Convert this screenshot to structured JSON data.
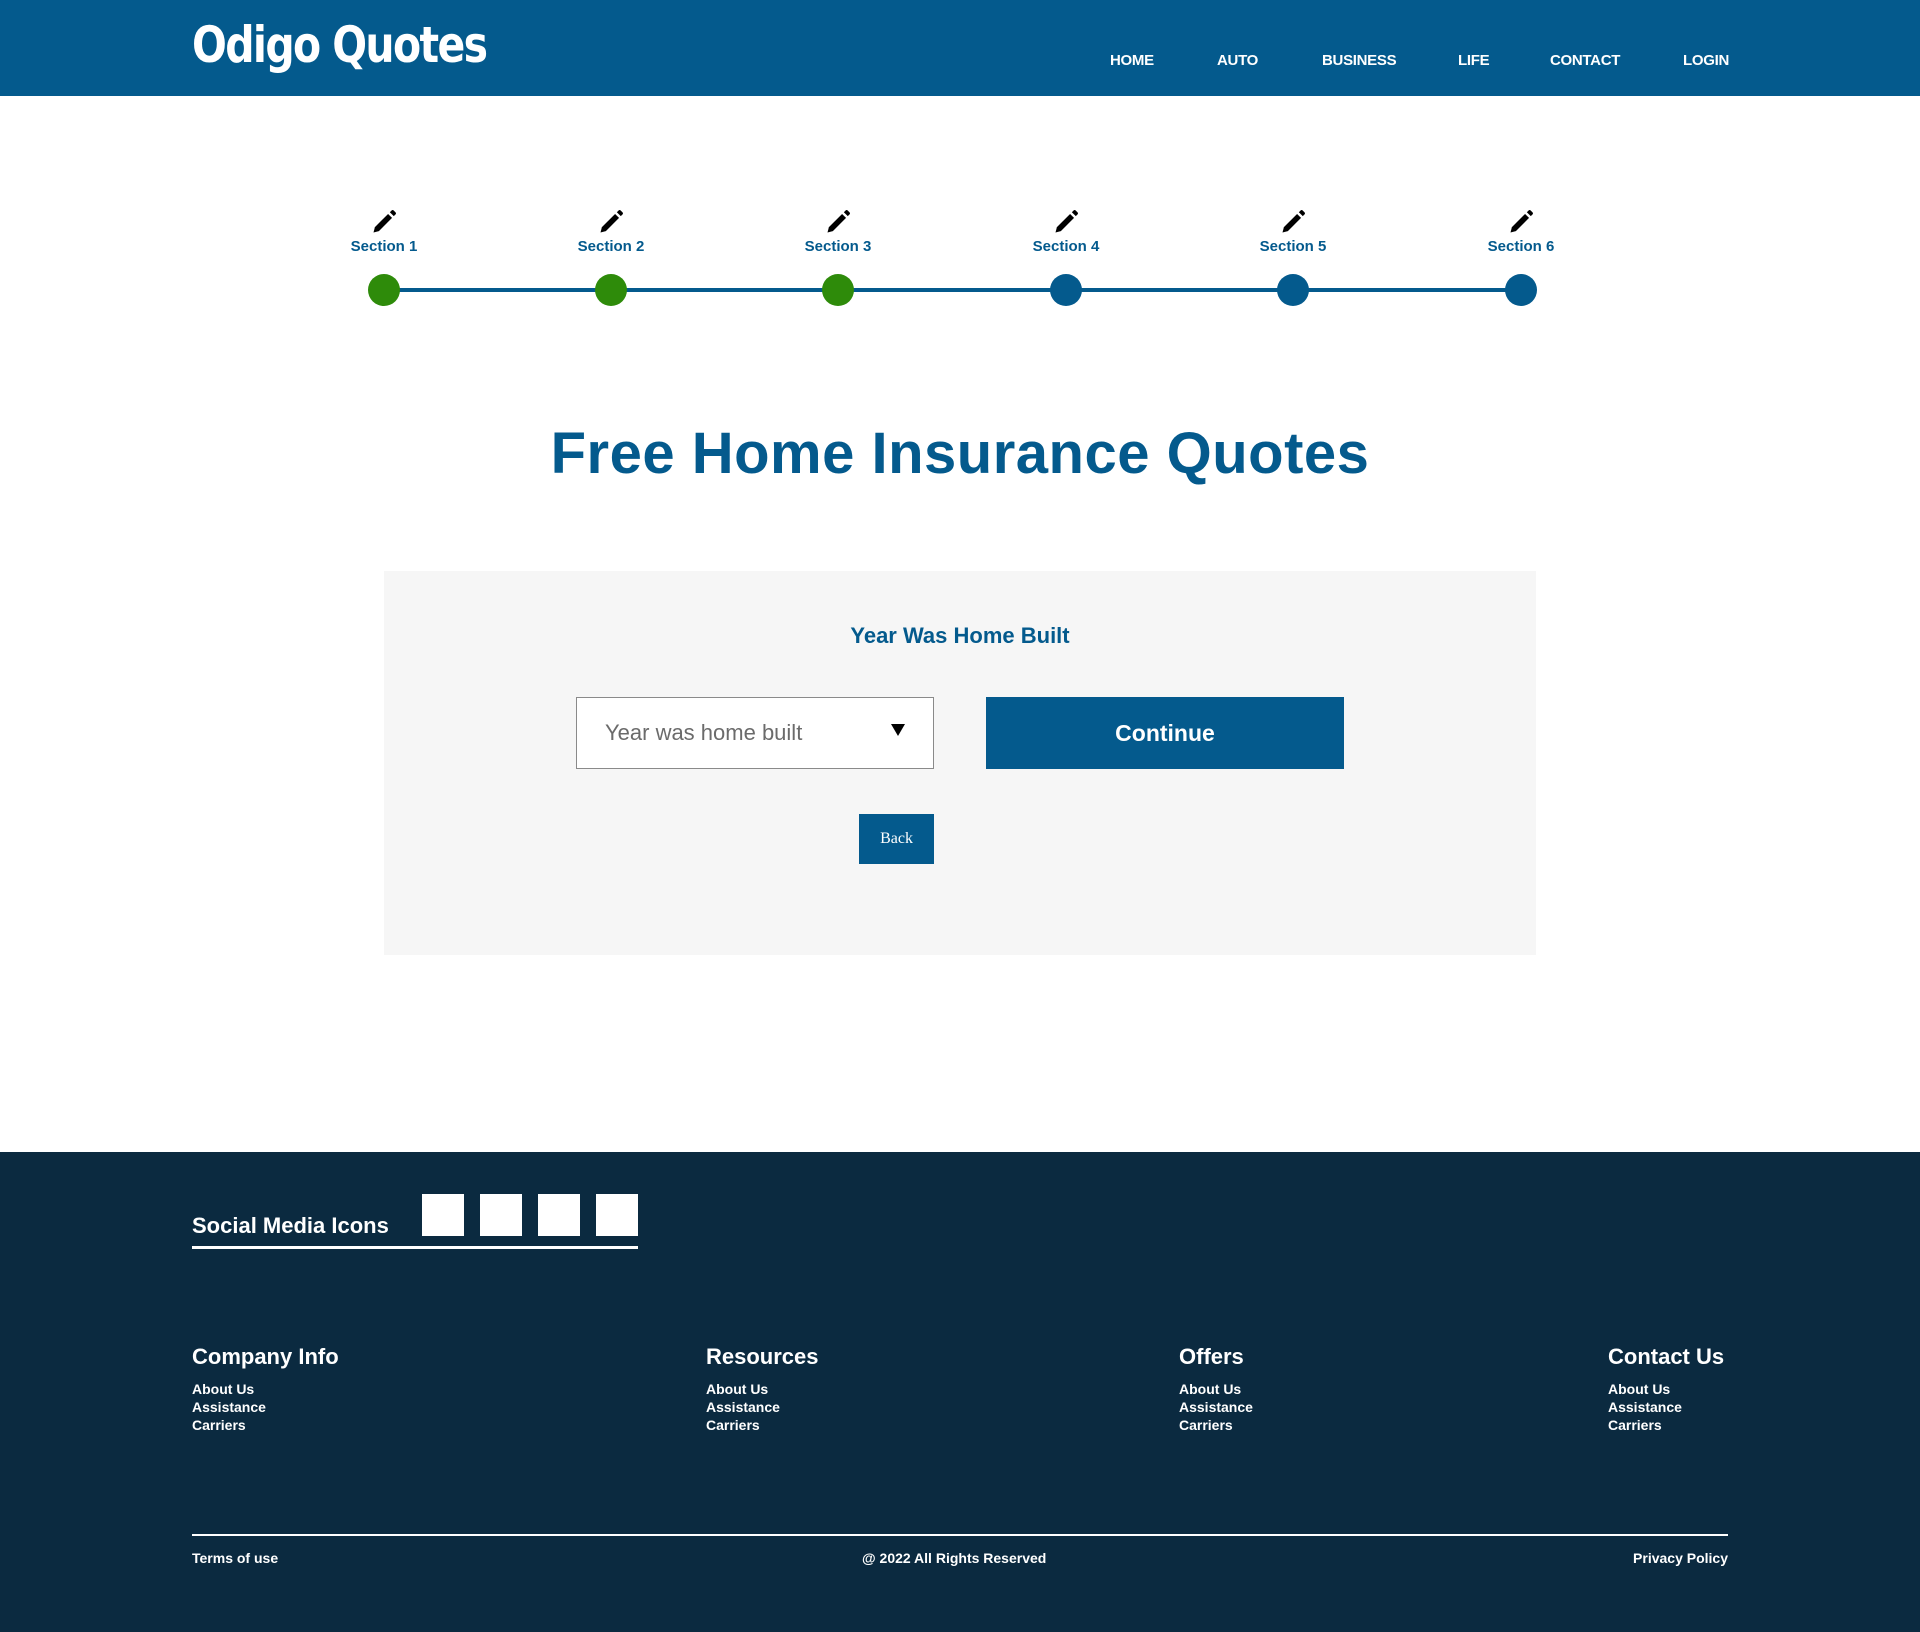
{
  "header": {
    "logo": "Odigo Quotes",
    "nav": [
      "HOME",
      "AUTO",
      "BUSINESS",
      "LIFE",
      "CONTACT",
      "LOGIN"
    ]
  },
  "progress": {
    "steps": [
      {
        "label": "Section 1",
        "status": "complete"
      },
      {
        "label": "Section 2",
        "status": "complete"
      },
      {
        "label": "Section 3",
        "status": "complete"
      },
      {
        "label": "Section 4",
        "status": "incomplete"
      },
      {
        "label": "Section 5",
        "status": "incomplete"
      },
      {
        "label": "Section 6",
        "status": "incomplete"
      }
    ],
    "icon": "pencil-icon",
    "colors": {
      "complete": "#2e8b0a",
      "incomplete": "#045a8d"
    }
  },
  "main": {
    "title": "Free Home Insurance Quotes",
    "form": {
      "question": "Year Was Home Built",
      "select_placeholder": "Year was home built",
      "continue_label": "Continue",
      "back_label": "Back"
    }
  },
  "footer": {
    "social_label": "Social Media Icons",
    "columns": [
      {
        "heading": "Company Info",
        "links": [
          "About Us",
          "Assistance",
          "Carriers"
        ]
      },
      {
        "heading": "Resources",
        "links": [
          "About Us",
          "Assistance",
          "Carriers"
        ]
      },
      {
        "heading": "Offers",
        "links": [
          "About Us",
          "Assistance",
          "Carriers"
        ]
      },
      {
        "heading": "Contact Us",
        "links": [
          "About Us",
          "Assistance",
          "Carriers"
        ]
      }
    ],
    "terms": "Terms of use",
    "copyright": "@ 2022 All Rights Reserved",
    "privacy": "Privacy Policy"
  },
  "colors": {
    "brand": "#045a8d",
    "footer_bg": "#0b2a40",
    "card_bg": "#f6f6f6"
  }
}
